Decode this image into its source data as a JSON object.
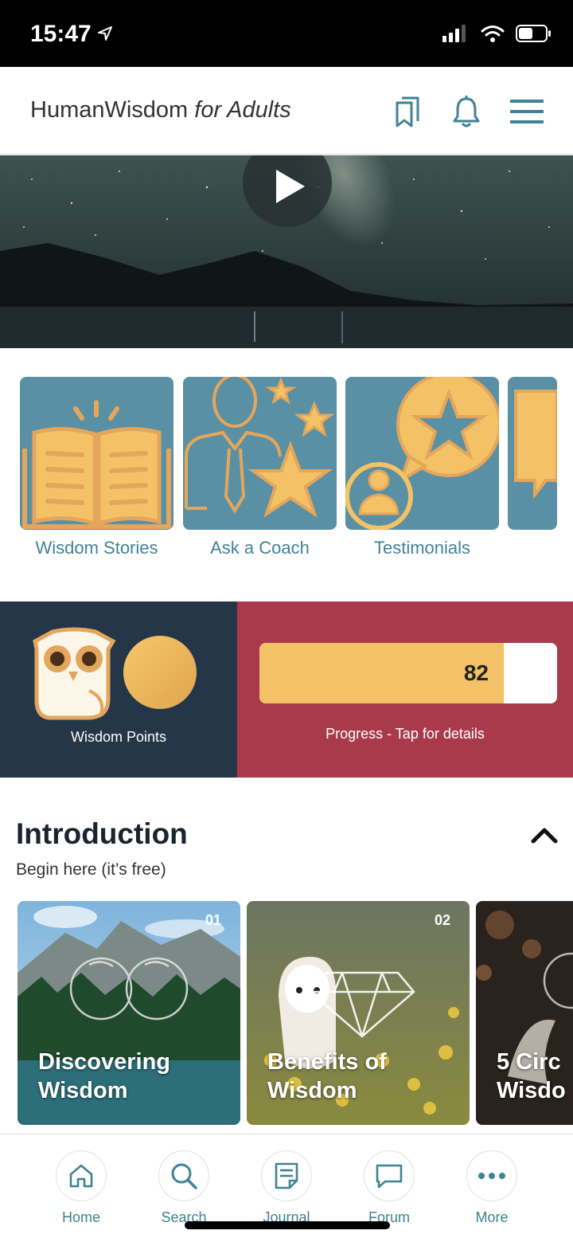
{
  "status": {
    "time": "15:47"
  },
  "header": {
    "title_main": "HumanWisdom",
    "title_emph": "for Adults"
  },
  "features": [
    {
      "label": "Wisdom Stories"
    },
    {
      "label": "Ask a Coach"
    },
    {
      "label": "Testimonials"
    }
  ],
  "points": {
    "label": "Wisdom Points"
  },
  "progress": {
    "value": "82",
    "fill_fraction": 0.82,
    "label": "Progress - Tap for details"
  },
  "intro": {
    "title": "Introduction",
    "subtitle": "Begin here (it’s free)",
    "cards": [
      {
        "num": "01",
        "title": "Discovering\nWisdom"
      },
      {
        "num": "02",
        "title": "Benefits of\nWisdom"
      },
      {
        "num": "",
        "title": "5 Circ\nWisdo"
      }
    ]
  },
  "nav": [
    {
      "label": "Home",
      "icon": "home-icon"
    },
    {
      "label": "Search",
      "icon": "search-icon"
    },
    {
      "label": "Journal",
      "icon": "journal-icon"
    },
    {
      "label": "Forum",
      "icon": "forum-icon"
    },
    {
      "label": "More",
      "icon": "more-icon"
    }
  ],
  "colors": {
    "accent": "#3f8395",
    "gold": "#f4c266",
    "navy": "#253648",
    "crimson": "#a93a4b"
  }
}
